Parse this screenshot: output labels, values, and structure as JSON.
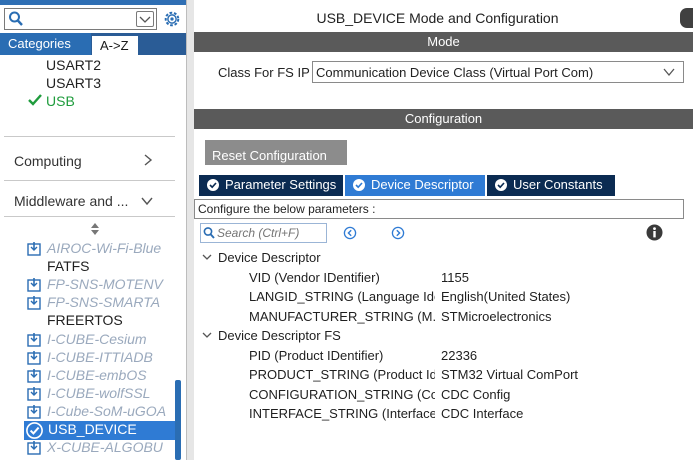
{
  "sidebar": {
    "search": {
      "value": "",
      "placeholder": ""
    },
    "tabs": {
      "categories": "Categories",
      "az": "A->Z"
    },
    "connectivity_items": [
      "USART2",
      "USART3"
    ],
    "usb_item": "USB",
    "groups": {
      "computing": "Computing",
      "middleware": "Middleware and ..."
    },
    "middleware_items": [
      {
        "label": "AIROC-Wi-Fi-Blue",
        "style": "gray"
      },
      {
        "label": "FATFS",
        "style": "plain"
      },
      {
        "label": "FP-SNS-MOTENV",
        "style": "gray"
      },
      {
        "label": "FP-SNS-SMARTA",
        "style": "gray"
      },
      {
        "label": "FREERTOS",
        "style": "plain"
      },
      {
        "label": "I-CUBE-Cesium",
        "style": "gray"
      },
      {
        "label": "I-CUBE-ITTIADB",
        "style": "gray"
      },
      {
        "label": "I-CUBE-embOS",
        "style": "gray"
      },
      {
        "label": "I-CUBE-wolfSSL",
        "style": "gray"
      },
      {
        "label": "I-Cube-SoM-uGOA",
        "style": "gray"
      },
      {
        "label": "USB_DEVICE",
        "style": "selected"
      },
      {
        "label": "X-CUBE-ALGOBU",
        "style": "gray"
      }
    ]
  },
  "main": {
    "title": "USB_DEVICE Mode and Configuration",
    "mode_header": "Mode",
    "class_label": "Class For FS IP",
    "class_value": "Communication Device Class (Virtual Port Com)",
    "config_header": "Configuration",
    "reset_label": "Reset Configuration",
    "tabs": [
      "Parameter Settings",
      "Device Descriptor",
      "User Constants"
    ],
    "active_tab": "Device Descriptor",
    "configure_text": "Configure the below parameters :",
    "search_placeholder": "Search (Ctrl+F)",
    "groups": [
      {
        "name": "Device Descriptor",
        "params": [
          {
            "name": "VID (Vendor IDentifier)",
            "value": "1155"
          },
          {
            "name": "LANGID_STRING (Language Ide...",
            "value": "English(United States)"
          },
          {
            "name": "MANUFACTURER_STRING (M...",
            "value": "STMicroelectronics"
          }
        ]
      },
      {
        "name": "Device Descriptor FS",
        "params": [
          {
            "name": "PID (Product IDentifier)",
            "value": "22336"
          },
          {
            "name": "PRODUCT_STRING (Product Id...",
            "value": "STM32 Virtual ComPort"
          },
          {
            "name": "CONFIGURATION_STRING (Co...",
            "value": "CDC Config"
          },
          {
            "name": "INTERFACE_STRING (Interface I...",
            "value": "CDC Interface"
          }
        ]
      }
    ]
  },
  "colors": {
    "accent": "#2f7bd4",
    "tab_dark": "#0b2b52",
    "header_gray": "#5a5a5a",
    "enabled_green": "#1f9c3d"
  },
  "icons": {
    "search": "search-icon",
    "gear": "gear-icon",
    "check": "check-icon",
    "middleware": "package-icon",
    "info": "info-icon"
  }
}
